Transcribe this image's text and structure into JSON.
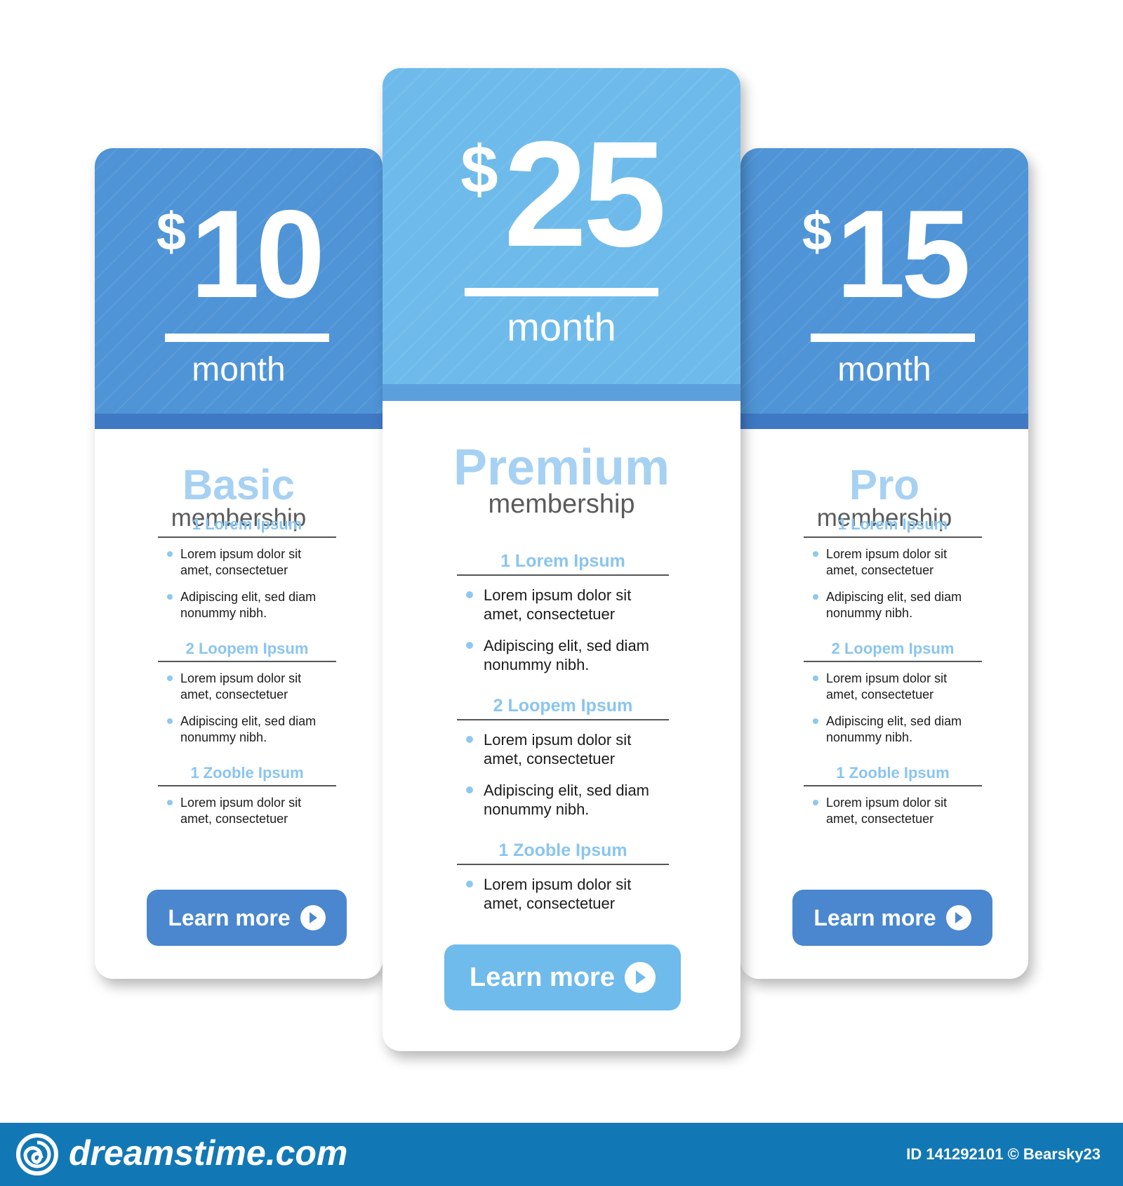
{
  "plans": [
    {
      "currency": "$",
      "amount": "10",
      "period": "month",
      "name": "Basic",
      "subtitle": "membership",
      "sections": [
        {
          "title": "1 Lorem Ipsum",
          "items": [
            "Lorem ipsum dolor sit amet, consectetuer",
            "Adipiscing elit, sed diam nonummy nibh."
          ]
        },
        {
          "title": "2 Loopem Ipsum",
          "items": [
            "Lorem ipsum dolor sit amet, consectetuer",
            "Adipiscing elit, sed diam nonummy nibh."
          ]
        },
        {
          "title": "1  Zooble Ipsum",
          "items": [
            "Lorem ipsum dolor sit amet, consectetuer"
          ]
        }
      ],
      "button_label": "Learn more"
    },
    {
      "currency": "$",
      "amount": "25",
      "period": "month",
      "name": "Premium",
      "subtitle": "membership",
      "sections": [
        {
          "title": "1 Lorem Ipsum",
          "items": [
            "Lorem ipsum dolor sit amet, consectetuer",
            "Adipiscing elit, sed diam nonummy nibh."
          ]
        },
        {
          "title": "2 Loopem Ipsum",
          "items": [
            "Lorem ipsum dolor sit amet, consectetuer",
            "Adipiscing elit, sed diam nonummy nibh."
          ]
        },
        {
          "title": "1  Zooble Ipsum",
          "items": [
            "Lorem ipsum dolor sit amet, consectetuer"
          ]
        }
      ],
      "button_label": "Learn more"
    },
    {
      "currency": "$",
      "amount": "15",
      "period": "month",
      "name": "Pro",
      "subtitle": "membership",
      "sections": [
        {
          "title": "1 Lorem Ipsum",
          "items": [
            "Lorem ipsum dolor sit amet, consectetuer",
            "Adipiscing elit, sed diam nonummy nibh."
          ]
        },
        {
          "title": "2 Loopem Ipsum",
          "items": [
            "Lorem ipsum dolor sit amet, consectetuer",
            "Adipiscing elit, sed diam nonummy nibh."
          ]
        },
        {
          "title": "1  Zooble Ipsum",
          "items": [
            "Lorem ipsum dolor sit amet, consectetuer"
          ]
        }
      ],
      "button_label": "Learn more"
    }
  ],
  "footer": {
    "brand": "dreamstime.com",
    "credit": "ID 141292101 © Bearsky23"
  },
  "colors": {
    "header_blue": "#4f94d6",
    "header_light_blue": "#6ebbeb",
    "accent_text": "#a6d1f3",
    "button_blue": "#4a87cf",
    "footer_blue": "#1278b5"
  }
}
